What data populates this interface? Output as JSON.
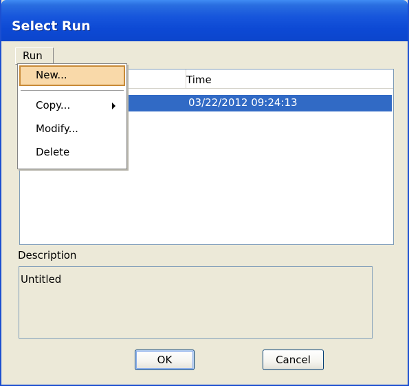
{
  "window": {
    "title": "Select Run"
  },
  "menubar": {
    "run_label": "Run"
  },
  "run_menu": {
    "items": [
      {
        "label": "New...",
        "highlighted": true
      },
      {
        "label": "Copy...",
        "has_submenu": true
      },
      {
        "label": "Modify..."
      },
      {
        "label": "Delete"
      }
    ]
  },
  "runs_table": {
    "columns": [
      "",
      "Time"
    ],
    "rows": [
      {
        "name": "",
        "time": "03/22/2012 09:24:13",
        "selected": true
      }
    ]
  },
  "description": {
    "label": "Description",
    "value": "Untitled"
  },
  "buttons": {
    "ok_label": "OK",
    "cancel_label": "Cancel"
  },
  "colors": {
    "titlebar": "#0d49d4",
    "selection": "#316ac5",
    "menu_highlight": "#f9d9a9",
    "dialog_bg": "#ece9d8"
  }
}
